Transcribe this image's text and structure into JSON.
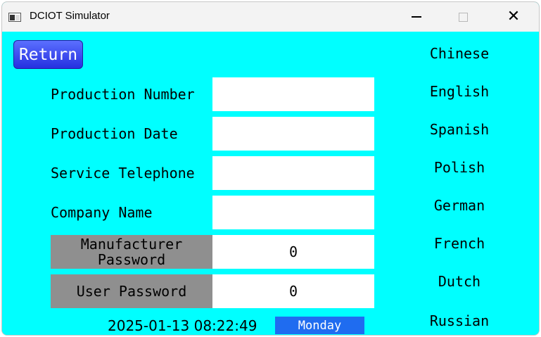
{
  "window": {
    "title": "DCIOT Simulator",
    "controls": {
      "minimize": "minimize-icon",
      "maximize": "maximize-icon",
      "close": "close-icon"
    }
  },
  "return_button": {
    "label": "Return"
  },
  "fields": [
    {
      "label": "Production Number",
      "value": ""
    },
    {
      "label": "Production Date",
      "value": ""
    },
    {
      "label": "Service Telephone",
      "value": ""
    },
    {
      "label": "Company Name",
      "value": ""
    }
  ],
  "passwords": [
    {
      "label_line1": "Manufacturer",
      "label_line2": "Password",
      "value": "0"
    },
    {
      "label": "User Password",
      "value": "0"
    }
  ],
  "languages": [
    "Chinese",
    "English",
    "Spanish",
    "Polish",
    "German",
    "French",
    "Dutch",
    "Russian"
  ],
  "status": {
    "datetime": "2025-01-13 08:22:49",
    "weekday": "Monday"
  },
  "colors": {
    "background": "#00ffff",
    "return_button": "#3a4cf0",
    "input_background": "#ffffff",
    "password_label_background": "#8f8f8f",
    "weekday_background": "#1f6cf0"
  }
}
